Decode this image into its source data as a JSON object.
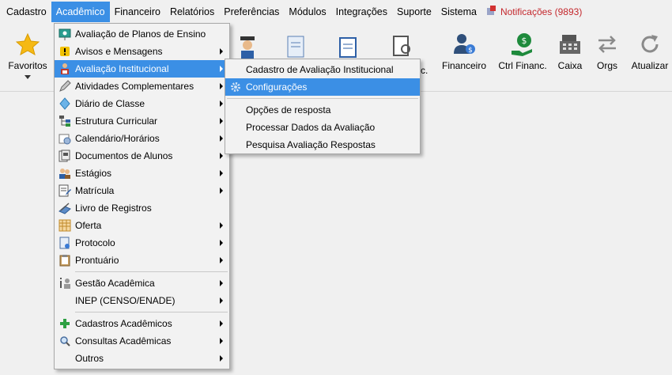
{
  "menubar": {
    "items": [
      "Cadastro",
      "Acadêmico",
      "Financeiro",
      "Relatórios",
      "Preferências",
      "Módulos",
      "Integrações",
      "Suporte",
      "Sistema"
    ],
    "notifications": "Notificações (9893)"
  },
  "toolbar": {
    "favoritos": "Favoritos",
    "partial_label": "c.",
    "financeiro": "Financeiro",
    "ctrl_financ": "Ctrl Financ.",
    "caixa": "Caixa",
    "orgs": "Orgs",
    "atualizar": "Atualizar"
  },
  "academico_menu": {
    "items": [
      "Avaliação de Planos de Ensino",
      "Avisos e Mensagens",
      "Avaliação Institucional",
      "Atividades Complementares",
      "Diário de Classe",
      "Estrutura Curricular",
      "Calendário/Horários",
      "Documentos de Alunos",
      "Estágios",
      "Matrícula",
      "Livro de Registros",
      "Oferta",
      "Protocolo",
      "Prontuário",
      "Gestão Acadêmica",
      "INEP (CENSO/ENADE)",
      "Cadastros Acadêmicos",
      "Consultas Acadêmicas",
      "Outros"
    ]
  },
  "avaliacao_submenu": {
    "items": [
      "Cadastro de Avaliação Institucional",
      "Configurações",
      "Opções de resposta",
      "Processar Dados da Avaliação",
      "Pesquisa Avaliação Respostas"
    ]
  },
  "colors": {
    "highlight": "#3b8fe5",
    "notification": "#c4282d"
  }
}
